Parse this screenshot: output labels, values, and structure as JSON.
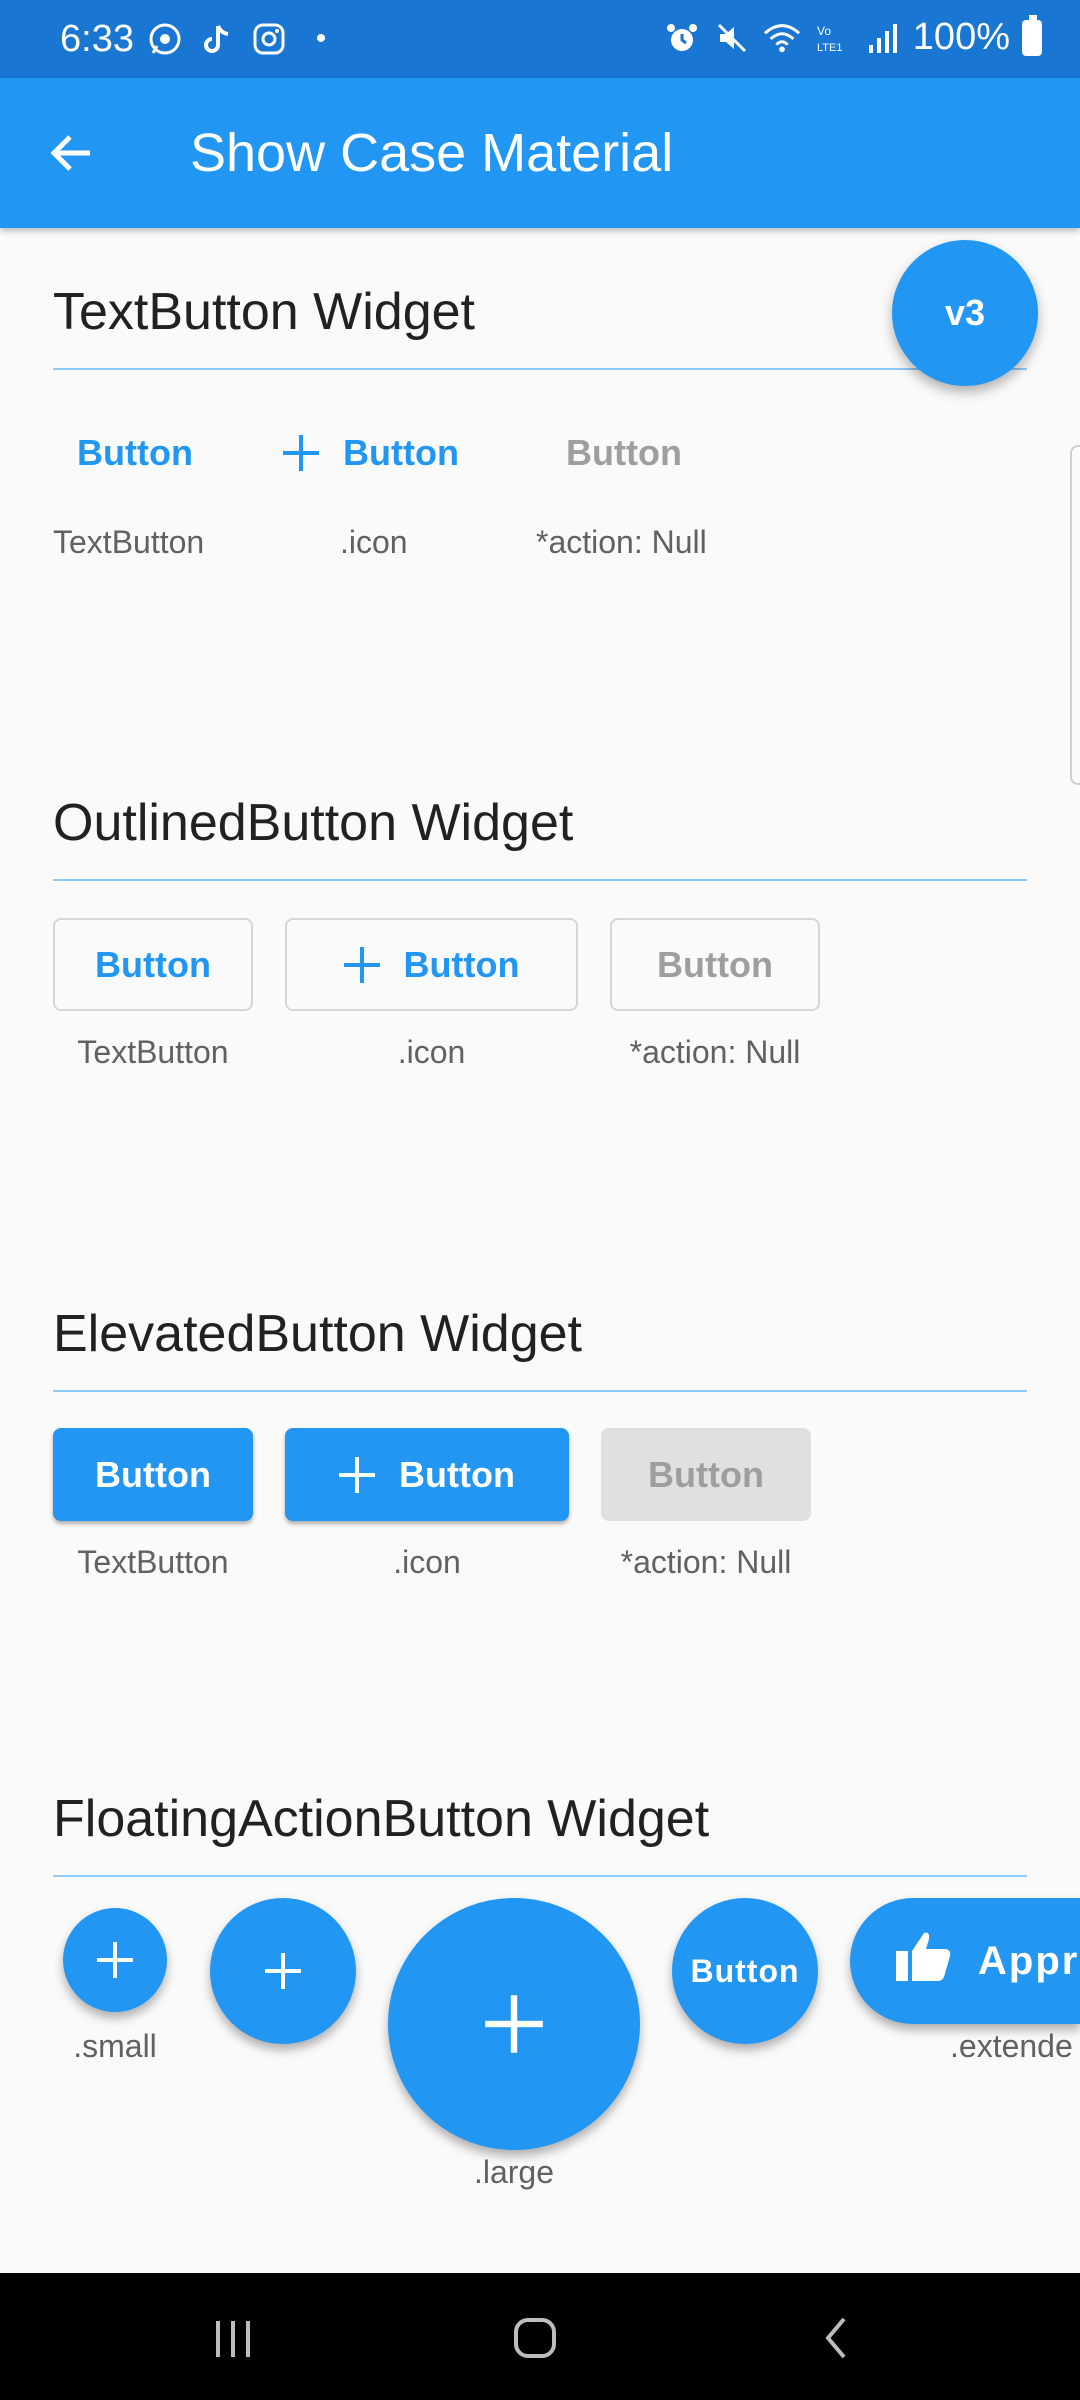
{
  "status_bar": {
    "time": "6:33",
    "dot": "•",
    "battery": "100%",
    "left_icons": [
      "whatsapp-icon",
      "tiktok-icon",
      "instagram-icon"
    ],
    "right_icons": [
      "alarm-icon",
      "mute-icon",
      "wifi-icon",
      "volte-icon",
      "signal-icon",
      "battery-icon"
    ]
  },
  "app_bar": {
    "title": "Show Case Material",
    "back_icon": "arrow-back-icon"
  },
  "fab_version": {
    "label": "v3"
  },
  "sections": {
    "text_button": {
      "title": "TextButton Widget",
      "buttons": [
        "Button",
        "Button",
        "Button"
      ],
      "labels": [
        "TextButton",
        ".icon",
        "*action: Null"
      ]
    },
    "outlined_button": {
      "title": "OutlinedButton Widget",
      "buttons": [
        "Button",
        "Button",
        "Button"
      ],
      "labels": [
        "TextButton",
        ".icon",
        "*action: Null"
      ]
    },
    "elevated_button": {
      "title": "ElevatedButton Widget",
      "buttons": [
        "Button",
        "Button",
        "Button"
      ],
      "labels": [
        "TextButton",
        ".icon",
        "*action: Null"
      ]
    },
    "fab": {
      "title": "FloatingActionButton Widget",
      "labels": [
        ".small",
        ".large",
        ".extende"
      ],
      "text_fab": "Button",
      "extended_label": "Appro"
    }
  },
  "colors": {
    "primary": "#2196f3",
    "status_bar": "#1976d2",
    "disabled_text": "#9e9e9e",
    "disabled_bg": "#e0e0e0"
  },
  "nav_bar": {
    "icons": [
      "recent-apps-icon",
      "home-icon",
      "back-icon"
    ]
  }
}
